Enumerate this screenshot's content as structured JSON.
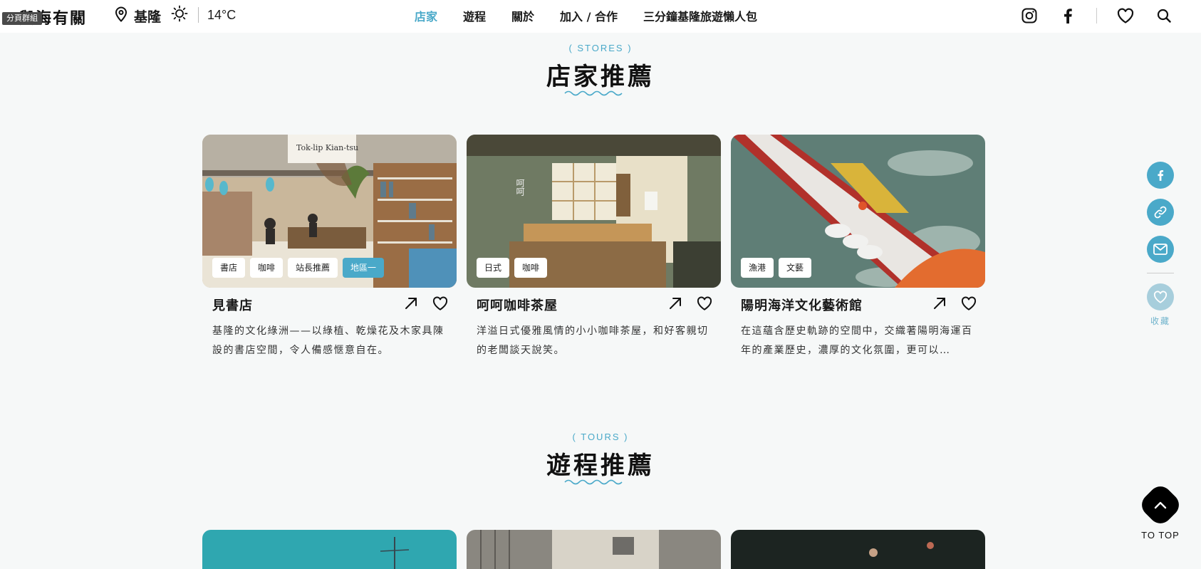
{
  "header": {
    "logo": "與海有關",
    "badge": "分頁群組",
    "location": "基隆",
    "temperature": "14°C",
    "nav": [
      "店家",
      "遊程",
      "關於",
      "加入 / 合作",
      "三分鐘基隆旅遊懶人包"
    ],
    "active_nav": "店家"
  },
  "stores_section": {
    "label": "( STORES )",
    "title": "店家推薦",
    "cards": [
      {
        "title": "見書店",
        "tags": [
          "書店",
          "咖啡",
          "站長推薦",
          "地區一"
        ],
        "desc": "基隆的文化綠洲——以綠植、乾燥花及木家具陳設的書店空間，令人備感愜意自在。",
        "image_sign": "Tok-lip Kian-tsu"
      },
      {
        "title": "呵呵咖啡茶屋",
        "tags": [
          "日式",
          "咖啡"
        ],
        "desc": "洋溢日式優雅風情的小小咖啡茶屋，和好客親切的老闆談天說笑。",
        "image_sign": "呵呵"
      },
      {
        "title": "陽明海洋文化藝術館",
        "tags": [
          "漁港",
          "文藝"
        ],
        "desc": "在這蘊含歷史軌跡的空間中，交織著陽明海運百年的產業歷史，濃厚的文化氛圍，更可以…"
      }
    ]
  },
  "tours_section": {
    "label": "( TOURS )",
    "title": "遊程推薦"
  },
  "side_bar": {
    "favorite_label": "收藏",
    "to_top_label": "TO TOP"
  },
  "colors": {
    "accent": "#4aa9c9",
    "background": "#f6f8f8"
  }
}
